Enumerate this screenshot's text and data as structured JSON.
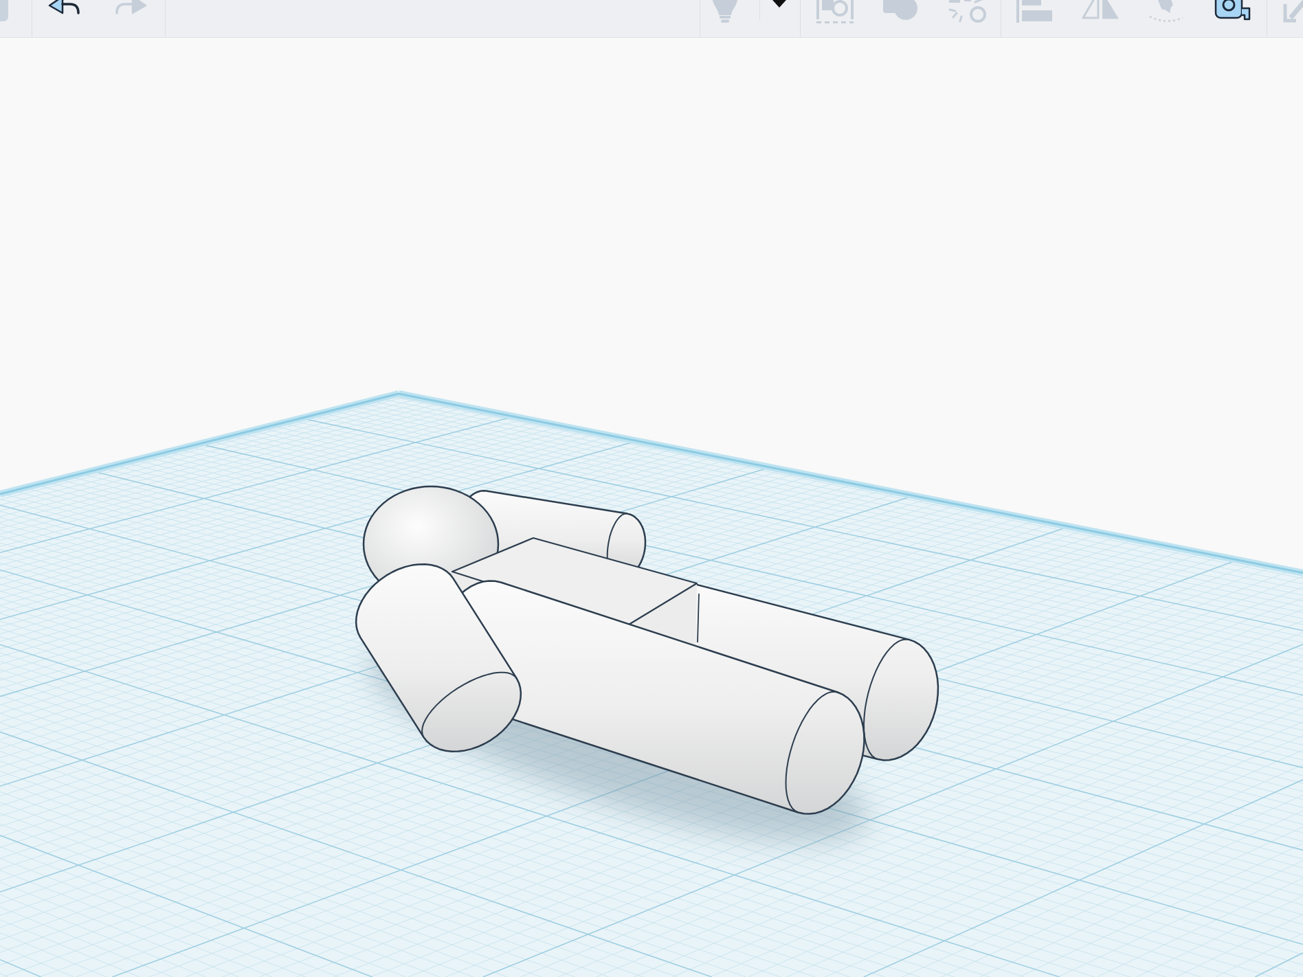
{
  "toolbar": {
    "sections": [
      {
        "tools": [
          {
            "kind": "cut-button"
          }
        ]
      },
      {
        "tools": [
          {
            "kind": "undo",
            "disabled": false
          },
          {
            "kind": "redo",
            "disabled": true
          }
        ]
      },
      {
        "tools": [
          {
            "kind": "lightbulb",
            "disabled": true
          },
          {
            "kind": "dropdown",
            "disabled": false
          }
        ]
      },
      {
        "tools": [
          {
            "kind": "square-circle",
            "disabled": true
          },
          {
            "kind": "merged-shapes",
            "disabled": true
          },
          {
            "kind": "circle-dashes",
            "disabled": true
          }
        ]
      },
      {
        "tools": [
          {
            "kind": "align-bars",
            "disabled": true
          },
          {
            "kind": "mirror-triangles",
            "disabled": true
          },
          {
            "kind": "marker-arc",
            "disabled": true
          },
          {
            "kind": "tape-measure",
            "disabled": false
          }
        ]
      },
      {
        "tools": [
          {
            "kind": "cut-icon",
            "disabled": true
          }
        ]
      }
    ]
  }
}
